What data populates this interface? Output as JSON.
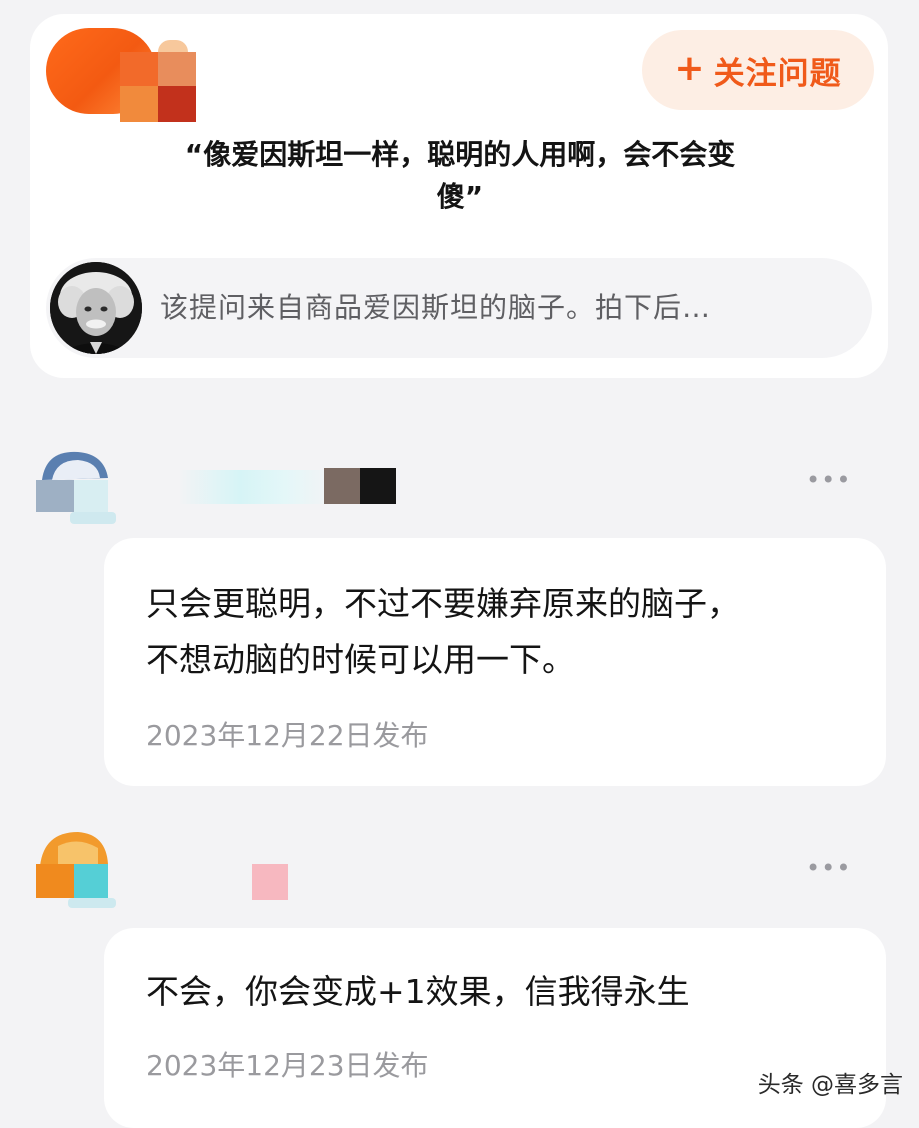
{
  "question": {
    "follow_label": "关注问题",
    "plus_symbol": "+",
    "title_line1": "“像爱因斯坦一样，聪明的人用啊，会不会变",
    "title_line2": "傻”",
    "source_text": "该提问来自商品爱因斯坦的脑子。拍下后…"
  },
  "answers": [
    {
      "text_line1": "只会更聪明，不过不要嫌弃原来的脑子，",
      "text_line2": "不想动脑的时候可以用一下。",
      "date": "2023年12月22日发布"
    },
    {
      "text_line1": "不会，你会变成+1效果，信我得永生",
      "date": "2023年12月23日发布"
    }
  ],
  "more_icon": "•••",
  "watermark": "头条 @喜多言",
  "colors": {
    "accent": "#f05a1a",
    "follow_bg": "#fdeee4",
    "page_bg": "#f3f3f5"
  },
  "icons": [
    "plus-icon",
    "more-icon"
  ]
}
